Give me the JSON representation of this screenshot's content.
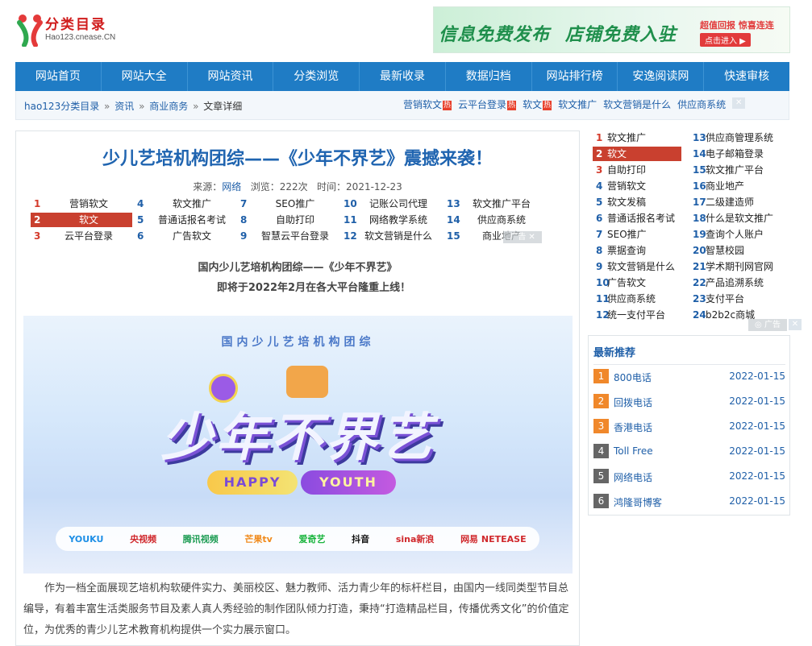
{
  "header": {
    "logo_title": "分类目录",
    "logo_sub": "Hao123.cnease.CN",
    "banner": {
      "text1": "信息免费发布",
      "text2": "店铺免费入驻",
      "cta_top": "超值回报 惊喜连连",
      "cta_bottom": "点击进入 ▶"
    }
  },
  "nav": [
    "网站首页",
    "网站大全",
    "网站资讯",
    "分类浏览",
    "最新收录",
    "数据归档",
    "网站排行榜",
    "安逸阅读网",
    "快速审核"
  ],
  "breadcrumb": {
    "home": "hao123分类目录",
    "sep": "»",
    "news": "资讯",
    "category": "商业商务",
    "current": "文章详细"
  },
  "hotlinks": [
    {
      "label": "营销软文",
      "hot": "热"
    },
    {
      "label": "云平台登录",
      "hot": "热"
    },
    {
      "label": "软文",
      "hot": "热"
    },
    {
      "label": "软文推广",
      "hot": ""
    },
    {
      "label": "软文营销是什么",
      "hot": ""
    },
    {
      "label": "供应商系统",
      "hot": ""
    }
  ],
  "ad_close": "✕",
  "ad_label": "广告",
  "ad_label_full": "◎ 广告",
  "article": {
    "title": "少儿艺培机构团综——《少年不界艺》震撼来袭！",
    "meta_source_label": "来源：",
    "meta_source": "网络",
    "meta_views": "浏览：222次",
    "meta_time": "时间：2021-12-23",
    "link_grid": [
      {
        "num": "1",
        "text": "营销软文"
      },
      {
        "num": "4",
        "text": "软文推广"
      },
      {
        "num": "7",
        "text": "SEO推广"
      },
      {
        "num": "10",
        "text": "记账公司代理"
      },
      {
        "num": "13",
        "text": "软文推广平台"
      },
      {
        "num": "2",
        "text": "软文"
      },
      {
        "num": "5",
        "text": "普通话报名考试"
      },
      {
        "num": "8",
        "text": "自助打印"
      },
      {
        "num": "11",
        "text": "网络教学系统"
      },
      {
        "num": "14",
        "text": "供应商系统"
      },
      {
        "num": "3",
        "text": "云平台登录"
      },
      {
        "num": "6",
        "text": "广告软文"
      },
      {
        "num": "9",
        "text": "智慧云平台登录"
      },
      {
        "num": "12",
        "text": "软文营销是什么"
      },
      {
        "num": "15",
        "text": "商业地产"
      }
    ],
    "lead1": "国内少儿艺培机构团综——《少年不界艺》",
    "lead2": "即将于2022年2月在各大平台隆重上线！",
    "poster": {
      "head": "国内少儿艺培机构团综",
      "main": "少年不界艺",
      "happy": "HAPPY",
      "youth": "YOUTH",
      "platforms": [
        {
          "name": "YOUKU",
          "color": "#1e8fe6"
        },
        {
          "name": "央视频",
          "color": "#d0282c"
        },
        {
          "name": "腾讯视频",
          "color": "#1f9d55"
        },
        {
          "name": "芒果tv",
          "color": "#f08a1c"
        },
        {
          "name": "爱奇艺",
          "color": "#18b43c"
        },
        {
          "name": "抖音",
          "color": "#111111"
        },
        {
          "name": "sina新浪",
          "color": "#d0282c"
        },
        {
          "name": "网易 NETEASE",
          "color": "#d0282c"
        }
      ]
    },
    "body": "作为一档全面展现艺培机构软硬件实力、美丽校区、魅力教师、活力青少年的标杆栏目，由国内一线同类型节目总编导，有着丰富生活类服务节目及素人真人秀经验的制作团队倾力打造，秉持“打造精品栏目，传播优秀文化”的价值定位，为优秀的青少儿艺术教育机构提供一个实力展示窗口。"
  },
  "sidebar": {
    "links": [
      {
        "num": "1",
        "text": "软文推广"
      },
      {
        "num": "13",
        "text": "供应商管理系统"
      },
      {
        "num": "2",
        "text": "软文"
      },
      {
        "num": "14",
        "text": "电子邮箱登录"
      },
      {
        "num": "3",
        "text": "自助打印"
      },
      {
        "num": "15",
        "text": "软文推广平台"
      },
      {
        "num": "4",
        "text": "营销软文"
      },
      {
        "num": "16",
        "text": "商业地产"
      },
      {
        "num": "5",
        "text": "软文发稿"
      },
      {
        "num": "17",
        "text": "二级建造师"
      },
      {
        "num": "6",
        "text": "普通话报名考试"
      },
      {
        "num": "18",
        "text": "什么是软文推广"
      },
      {
        "num": "7",
        "text": "SEO推广"
      },
      {
        "num": "19",
        "text": "查询个人账户"
      },
      {
        "num": "8",
        "text": "票据查询"
      },
      {
        "num": "20",
        "text": "智慧校园"
      },
      {
        "num": "9",
        "text": "软文营销是什么"
      },
      {
        "num": "21",
        "text": "学术期刊网官网"
      },
      {
        "num": "10",
        "text": "广告软文"
      },
      {
        "num": "22",
        "text": "产品追溯系统"
      },
      {
        "num": "11",
        "text": "供应商系统"
      },
      {
        "num": "23",
        "text": "支付平台"
      },
      {
        "num": "12",
        "text": "统一支付平台"
      },
      {
        "num": "24",
        "text": "b2b2c商城"
      }
    ],
    "recommend_title": "最新推荐",
    "recommend": [
      {
        "num": "1",
        "name": "800电话",
        "date": "2022-01-15"
      },
      {
        "num": "2",
        "name": "回拨电话",
        "date": "2022-01-15"
      },
      {
        "num": "3",
        "name": "香港电话",
        "date": "2022-01-15"
      },
      {
        "num": "4",
        "name": "Toll Free",
        "date": "2022-01-15"
      },
      {
        "num": "5",
        "name": "网络电话",
        "date": "2022-01-15"
      },
      {
        "num": "6",
        "name": "鸿隆哥博客",
        "date": "2022-01-15"
      }
    ]
  }
}
